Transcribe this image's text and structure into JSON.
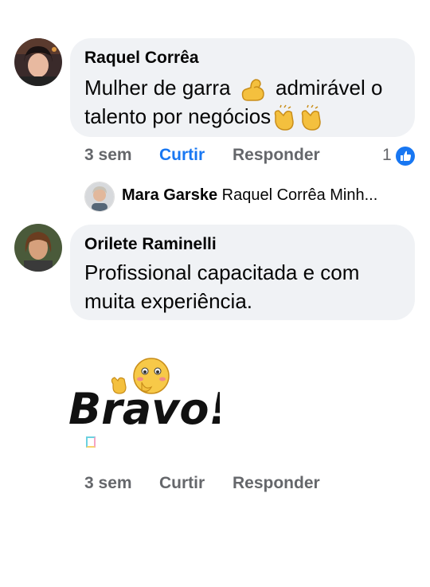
{
  "comments": [
    {
      "author": "Raquel Corrêa",
      "text_line1": "Mulher de garra",
      "text_line1_end": "admirável o",
      "text_line2": "talento por negócios",
      "time": "3 sem",
      "like_label": "Curtir",
      "reply_label": "Responder",
      "reaction_count": "1",
      "liked": true,
      "emoji_icons": [
        "flexed-biceps-icon",
        "clapping-hands-icon",
        "clapping-hands-icon"
      ]
    },
    {
      "author": "Orilete Raminelli",
      "text_line1": "Profissional capacitada e com",
      "text_line2": "muita experiência.",
      "time": "3 sem",
      "like_label": "Curtir",
      "reply_label": "Responder",
      "sticker_text": "Bravo!"
    }
  ],
  "reply_preview": {
    "author": "Mara Garske",
    "text": "Raquel Corrêa  Minh..."
  },
  "colors": {
    "bubble": "#f0f2f5",
    "action_gray": "#65676b",
    "like_blue": "#1877f2"
  }
}
